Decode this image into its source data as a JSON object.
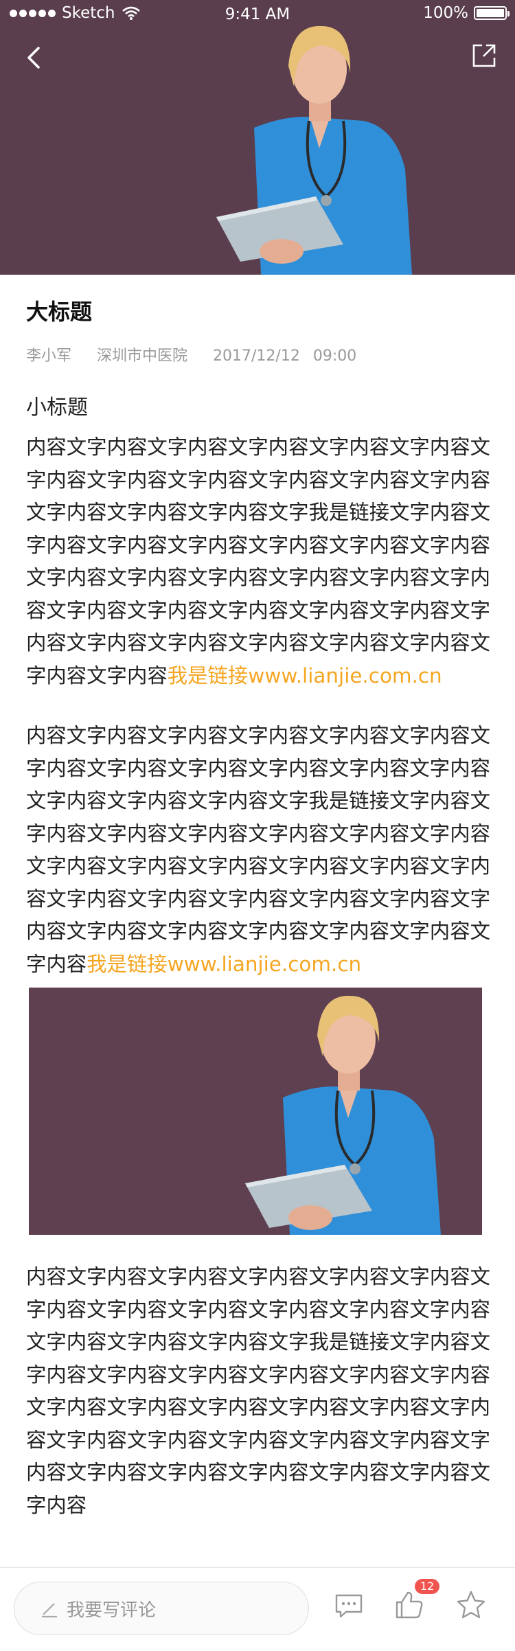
{
  "status_bar": {
    "carrier": "Sketch",
    "time": "9:41 AM",
    "battery": "100%"
  },
  "hero": {
    "background_color": "#5b3e4d",
    "back_icon": "chevron-left-icon",
    "share_icon": "share-icon"
  },
  "article": {
    "title": "大标题",
    "meta": {
      "author": "李小军",
      "hospital": "深圳市中医院",
      "date": "2017/12/12",
      "time": "09:00"
    },
    "subtitle": "小标题",
    "paragraph_1": {
      "text": "内容文字内容文字内容文字内容文字内容文字内容文字内容文字内容文字内容文字内容文字内容文字内容文字内容文字内容文字内容文字我是链接文字内容文字内容文字内容文字内容文字内容文字内容文字内容文字内容文字内容文字内容文字内容文字内容文字内容文字内容文字内容文字内容文字内容文字内容文字内容文字内容文字内容文字内容文字内容文字内容文字内容文字内容",
      "link": "我是链接www.lianjie.com.cn"
    },
    "paragraph_2": {
      "text": "内容文字内容文字内容文字内容文字内容文字内容文字内容文字内容文字内容文字内容文字内容文字内容文字内容文字内容文字内容文字我是链接文字内容文字内容文字内容文字内容文字内容文字内容文字内容文字内容文字内容文字内容文字内容文字内容文字内容文字内容文字内容文字内容文字内容文字内容文字内容文字内容文字内容文字内容文字内容文字内容文字内容",
      "link": "我是链接www.lianjie.com.cn"
    },
    "paragraph_3": {
      "text": "内容文字内容文字内容文字内容文字内容文字内容文字内容文字内容文字内容文字内容文字内容文字内容文字内容文字内容文字内容文字我是链接文字内容文字内容文字内容文字内容文字内容文字内容文字内容文字内容文字内容文字内容文字内容文字内容文字内容文字内容文字内容文字内容文字内容文字内容文字内容文字内容文字内容文字内容文字内容文字内容文字内容"
    },
    "link_color": "#f5a623"
  },
  "bottom_bar": {
    "comment_placeholder": "我要写评论",
    "like_count": "12",
    "badge_color": "#f0544f"
  }
}
